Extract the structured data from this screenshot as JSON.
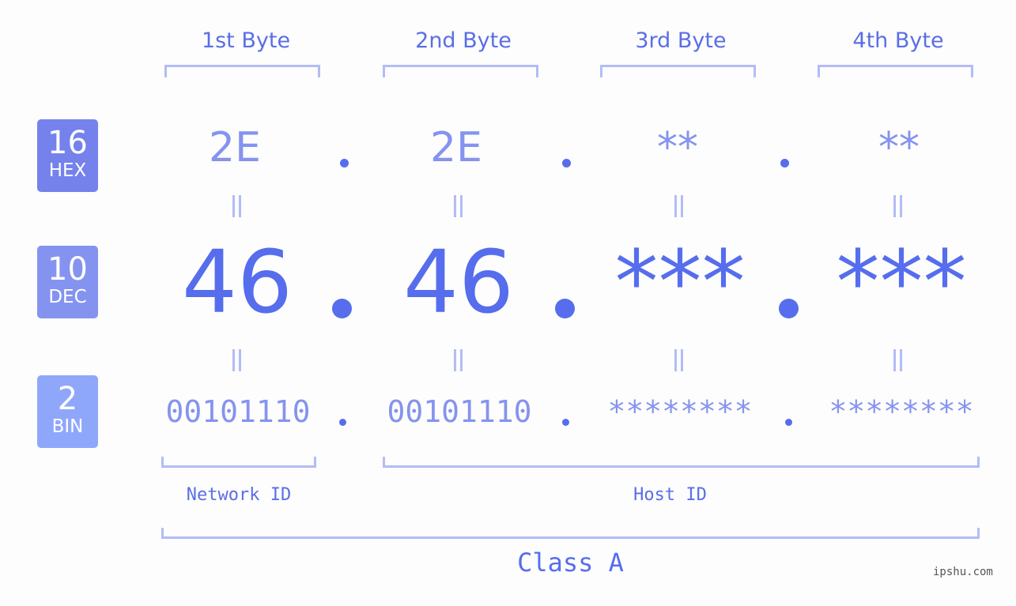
{
  "bytes": {
    "labels": [
      "1st Byte",
      "2nd Byte",
      "3rd Byte",
      "4th Byte"
    ]
  },
  "bases": {
    "hex": {
      "number": "16",
      "unit": "HEX",
      "color": "#7582ec"
    },
    "dec": {
      "number": "10",
      "unit": "DEC",
      "color": "#8593f0"
    },
    "bin": {
      "number": "2",
      "unit": "BIN",
      "color": "#8fa7fa"
    }
  },
  "address": {
    "hex": [
      "2E",
      "2E",
      "**",
      "**"
    ],
    "dec": [
      "46",
      "46",
      "***",
      "***"
    ],
    "bin": [
      "00101110",
      "00101110",
      "********",
      "********"
    ]
  },
  "segments": {
    "network_id": "Network ID",
    "host_id": "Host ID"
  },
  "ip_class": "Class A",
  "watermark": "ipshu.com",
  "colors": {
    "accent": "#566ded",
    "bracket": "#b3bcf7",
    "light_value": "#8593ef"
  }
}
